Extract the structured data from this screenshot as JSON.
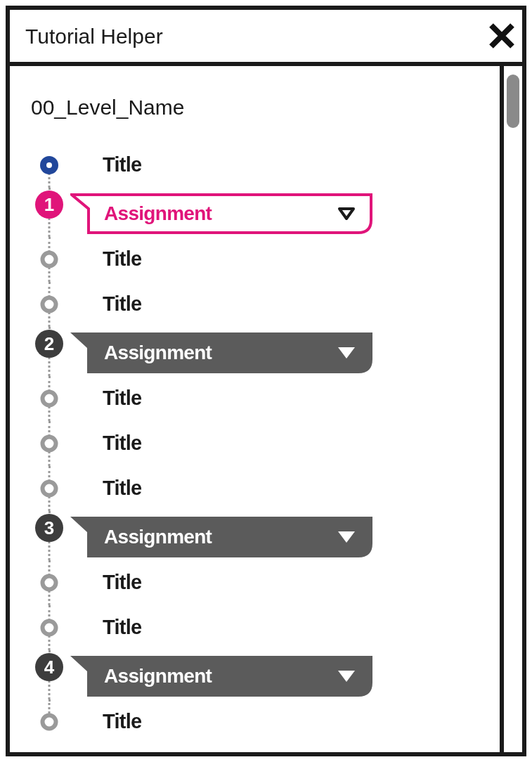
{
  "window": {
    "title": "Tutorial Helper"
  },
  "level_name": "00_Level_Name",
  "items": [
    {
      "kind": "step",
      "title": "Title",
      "current": true
    },
    {
      "kind": "assignment",
      "number": "1",
      "label": "Assignment",
      "selected": true
    },
    {
      "kind": "step",
      "title": "Title",
      "current": false
    },
    {
      "kind": "step",
      "title": "Title",
      "current": false
    },
    {
      "kind": "assignment",
      "number": "2",
      "label": "Assignment",
      "selected": false
    },
    {
      "kind": "step",
      "title": "Title",
      "current": false
    },
    {
      "kind": "step",
      "title": "Title",
      "current": false
    },
    {
      "kind": "step",
      "title": "Title",
      "current": false
    },
    {
      "kind": "assignment",
      "number": "3",
      "label": "Assignment",
      "selected": false
    },
    {
      "kind": "step",
      "title": "Title",
      "current": false
    },
    {
      "kind": "step",
      "title": "Title",
      "current": false
    },
    {
      "kind": "assignment",
      "number": "4",
      "label": "Assignment",
      "selected": false
    },
    {
      "kind": "step",
      "title": "Title",
      "current": false
    }
  ]
}
